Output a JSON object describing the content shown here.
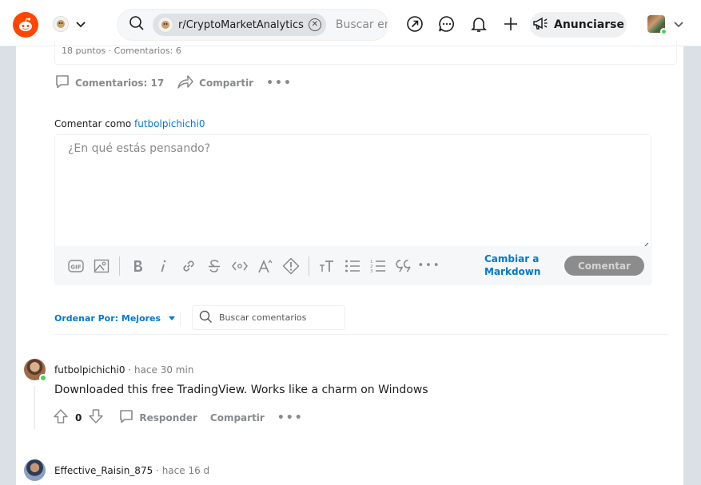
{
  "header": {
    "community_chip": "r/CryptoMarketAnalytics",
    "search_placeholder": "Buscar en R",
    "advertise_label": "Anunciarse"
  },
  "post": {
    "stats_text": "18 puntos · Comentarios: 6",
    "comments_label": "Comentarios: 17",
    "share_label": "Compartir",
    "more_label": "•••"
  },
  "composer": {
    "comment_as_prefix": "Comentar como",
    "comment_as_user": "futbolpichichi0",
    "placeholder": "¿En qué estás pensando?",
    "markdown_line1": "Cambiar a",
    "markdown_line2": "Markdown",
    "submit_label": "Comentar",
    "toolbar": {
      "gif": "GIF",
      "bold": "B",
      "italic": "i",
      "superscript": "A^",
      "heading": "TT",
      "quote": "99",
      "code": "<c>",
      "more": "•••"
    }
  },
  "sort": {
    "label": "Ordenar Por: Mejores",
    "search_placeholder": "Buscar comentarios"
  },
  "comments": [
    {
      "author": "futbolpichichi0",
      "time": "hace 30 min",
      "body": "Downloaded this free TradingView. Works like a charm on Windows",
      "votes": "0",
      "reply_label": "Responder",
      "share_label": "Compartir",
      "more_label": "•••"
    },
    {
      "author": "Effective_Raisin_875",
      "time": "hace 16 d"
    }
  ],
  "colors": {
    "brand": "#ff4500",
    "link": "#0079d3",
    "muted": "#878a8c",
    "online": "#46d160"
  }
}
